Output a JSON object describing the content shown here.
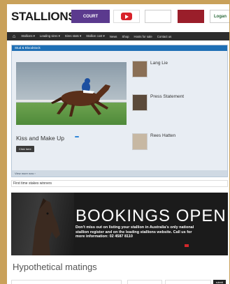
{
  "header": {
    "logo": "STALLIONS",
    "ads": {
      "court_top": "",
      "court": "COURT",
      "play": "",
      "blank": "",
      "red": "",
      "logan": "Logan"
    }
  },
  "nav": {
    "items": [
      "Stallions ▾",
      "Leading sires ▾",
      "Sires stats ▾",
      "Stallion cost ▾",
      "News",
      "Shop",
      "Hosts for sale",
      "Contact us"
    ]
  },
  "featured": {
    "bar_title": "Stud & Bloodstock",
    "bar_link": "",
    "title": "Kiss and Make Up",
    "sub": "",
    "badge": "",
    "button": "Click here",
    "footer": "View more now ›"
  },
  "cards": [
    {
      "name": "Lang Lie",
      "sub": "",
      "text": "",
      "button": ""
    },
    {
      "name": "Press Statement",
      "sub": "",
      "text": "",
      "button": ""
    },
    {
      "name": "Rees Hatten",
      "sub": "",
      "text": "",
      "button": ""
    }
  ],
  "stakes": {
    "label": "First time stakes winners",
    "ticker": "",
    "controls": ""
  },
  "banner": {
    "title": "BOOKINGS OPEN",
    "text": "Don't miss out on listing your stallion in Australia's only national stallion register and on the leading stallions website. Call us for more information: 02 4587 8110",
    "button": ""
  },
  "matings": {
    "title": "Hypothetical matings",
    "sub": "",
    "fields": [
      "",
      "",
      ""
    ],
    "submit": "submit"
  }
}
